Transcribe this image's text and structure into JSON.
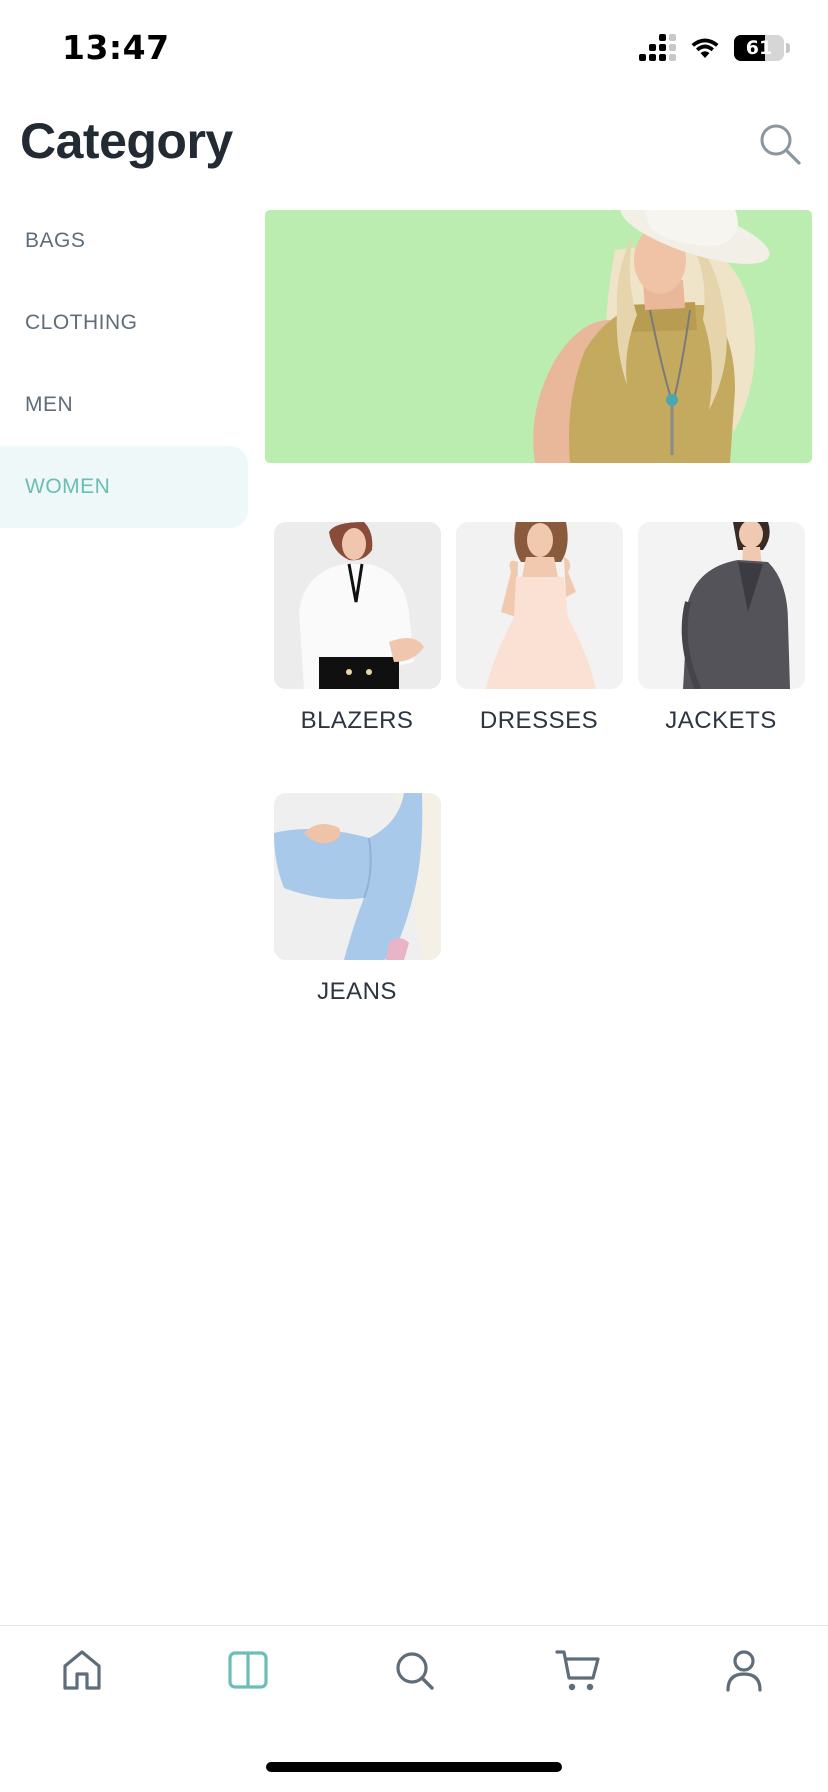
{
  "status_bar": {
    "time": "13:47",
    "battery": "61",
    "battery_level": 0.61,
    "icons": [
      "cellular-signal-icon",
      "wifi-icon",
      "battery-icon"
    ]
  },
  "header": {
    "title": "Category",
    "search_icon": "search-icon"
  },
  "sidebar": {
    "items": [
      {
        "label": "BAGS",
        "active": false
      },
      {
        "label": "CLOTHING",
        "active": false
      },
      {
        "label": "MEN",
        "active": false
      },
      {
        "label": "WOMEN",
        "active": true
      }
    ]
  },
  "banner": {
    "background": "#bbedb1"
  },
  "subcategories": [
    {
      "label": "BLAZERS"
    },
    {
      "label": "DRESSES"
    },
    {
      "label": "JACKETS"
    },
    {
      "label": "JEANS"
    }
  ],
  "bottom_nav": {
    "items": [
      {
        "icon": "home-icon",
        "active": false
      },
      {
        "icon": "category-icon",
        "active": true
      },
      {
        "icon": "search-icon",
        "active": false
      },
      {
        "icon": "cart-icon",
        "active": false
      },
      {
        "icon": "profile-icon",
        "active": false
      }
    ]
  },
  "colors": {
    "accent": "#6bbdb6",
    "active_bg": "#eef8f8",
    "text": "#222b33",
    "muted": "#5f6d7a",
    "icon": "#5f6d7a"
  }
}
